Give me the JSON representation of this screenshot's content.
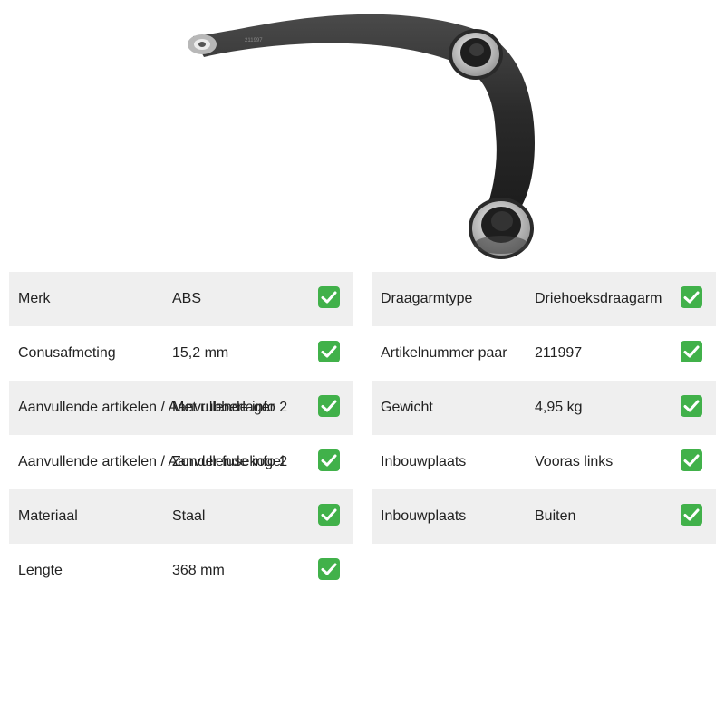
{
  "product": {
    "image_name": "control-arm-image",
    "part_marking": "211997"
  },
  "specs_left": [
    {
      "label": "Merk",
      "value": "ABS",
      "shaded": true
    },
    {
      "label": "Conusafmeting",
      "value": "15,2 mm",
      "shaded": false
    },
    {
      "label": "Aanvullende artikelen / Aanvullende info 2",
      "value": "Met rubberlager",
      "shaded": true
    },
    {
      "label": "Aanvullende artikelen / Aanvullende info 2",
      "value": "Zonder fusekogel",
      "shaded": false
    },
    {
      "label": "Materiaal",
      "value": "Staal",
      "shaded": true
    },
    {
      "label": "Lengte",
      "value": "368 mm",
      "shaded": false
    }
  ],
  "specs_right": [
    {
      "label": "Draagarmtype",
      "value": "Driehoeksdraagarm",
      "shaded": true
    },
    {
      "label": "Artikelnummer paar",
      "value": "211997",
      "shaded": false
    },
    {
      "label": "Gewicht",
      "value": "4,95 kg",
      "shaded": true
    },
    {
      "label": "Inbouwplaats",
      "value": "Vooras links",
      "shaded": false
    },
    {
      "label": "Inbouwplaats",
      "value": "Buiten",
      "shaded": true
    }
  ],
  "colors": {
    "row_shade": "#efefef",
    "check_green": "#41b14a",
    "arm_black": "#2b2b2b"
  },
  "icons": {
    "verified": "check-mark-icon"
  }
}
